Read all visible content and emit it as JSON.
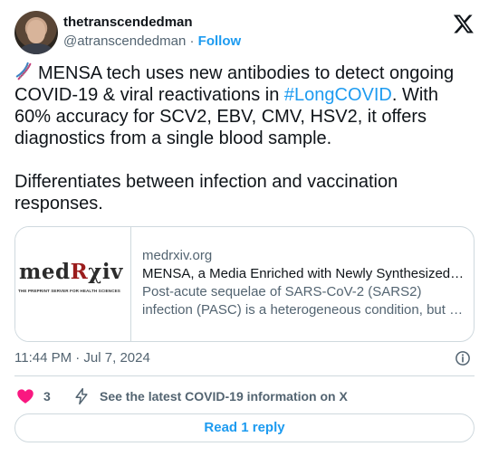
{
  "author": {
    "display_name": "thetranscendedman",
    "handle": "@atranscendedman",
    "separator": "·",
    "follow_label": "Follow"
  },
  "tweet": {
    "text_part1": "MENSA tech uses new antibodies to detect ongoing COVID-19 & viral reactivations in ",
    "hashtag": "#LongCOVID",
    "text_part2": ". With 60% accuracy for SCV2, EBV, CMV, HSV2, it offers diagnostics from a single blood sample.\n\nDifferentiates between infection and vaccination responses.",
    "emoji_icon": "dna-icon"
  },
  "card": {
    "logo_text_med": "med",
    "logo_text_r": "R",
    "logo_text_xiv": "χiv",
    "logo_subtitle": "THE PREPRINT SERVER FOR HEALTH SCIENCES",
    "domain": "medrxiv.org",
    "title": "MENSA, a Media Enriched with Newly Synthesized Antibodies",
    "desc_line1": "Post-acute sequelae of SARS-CoV-2 (SARS2)",
    "desc_line2": "infection (PASC) is a heterogeneous condition, but the"
  },
  "meta": {
    "timestamp": "11:44 PM · Jul 7, 2024"
  },
  "actions": {
    "like_count": "3",
    "latest_label": "See the latest COVID-19 information on X"
  },
  "reply_button": "Read 1 reply",
  "colors": {
    "accent": "#1d9bf0",
    "heart": "#f91880",
    "text": "#0f1419",
    "muted": "#536471",
    "border": "#cfd9de"
  }
}
